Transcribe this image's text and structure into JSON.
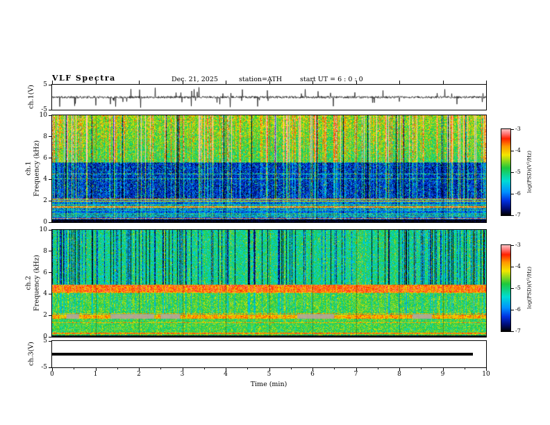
{
  "header": {
    "title": "VLF Spectra",
    "date": "Dec. 21, 2025",
    "station": "station=ATH",
    "start_ut": "start UT =  6 : 0 : 0"
  },
  "axes": {
    "x": {
      "label": "Time (min)",
      "ticks": [
        "0",
        "1",
        "2",
        "3",
        "4",
        "5",
        "6",
        "7",
        "8",
        "9",
        "10"
      ],
      "range": [
        0,
        10
      ]
    },
    "wave1": {
      "label": "ch.1(V)",
      "ticks": [
        "5",
        "-5"
      ],
      "range": [
        -5,
        5
      ]
    },
    "spec1": {
      "channel": "ch.1",
      "freq_label": "Frequency (kHz)",
      "ticks": [
        "10",
        "8",
        "6",
        "4",
        "2",
        "0"
      ],
      "range": [
        0,
        10
      ]
    },
    "spec2": {
      "channel": "ch.2",
      "freq_label": "Frequency (kHz)",
      "ticks": [
        "10",
        "8",
        "6",
        "4",
        "2",
        "0"
      ],
      "range": [
        0,
        10
      ]
    },
    "wave3": {
      "label": "ch.3(V)",
      "ticks": [
        "5",
        "-5"
      ],
      "range": [
        -5,
        5
      ]
    }
  },
  "colorbar": {
    "label": "log(PSD)(V²/Hz)",
    "ticks": [
      "-3",
      "-4",
      "-5",
      "-6",
      "-7"
    ],
    "range": [
      -7,
      -3
    ],
    "stops": [
      {
        "pos": 0.0,
        "color": "#ffc2c2"
      },
      {
        "pos": 0.05,
        "color": "#ff7a7a"
      },
      {
        "pos": 0.11,
        "color": "#ff2000"
      },
      {
        "pos": 0.2,
        "color": "#ff9800"
      },
      {
        "pos": 0.3,
        "color": "#f2e600"
      },
      {
        "pos": 0.45,
        "color": "#1ec83c"
      },
      {
        "pos": 0.6,
        "color": "#00dcd4"
      },
      {
        "pos": 0.73,
        "color": "#0090ff"
      },
      {
        "pos": 0.83,
        "color": "#0030e0"
      },
      {
        "pos": 0.92,
        "color": "#000c78"
      },
      {
        "pos": 1.0,
        "color": "#000000"
      }
    ]
  },
  "chart_data": [
    {
      "type": "line",
      "name": "ch1-waveform",
      "description": "ch.1 voltage time series: broadband noise around 0 V with frequent impulsive sferic spikes reaching ±5 V across the full 10 minutes",
      "x_range": [
        0,
        10
      ],
      "y_range": [
        -5,
        5
      ],
      "gen": {
        "seed": 11,
        "base_amp": 0.5,
        "spike_prob": 0.045,
        "spike_amp": [
          1.5,
          4.6
        ]
      }
    },
    {
      "type": "heatmap",
      "name": "ch1-spectrogram",
      "description": "ch.1 VLF spectrogram 0-10 kHz: green background with yellow/red vertical sferic streaks above ~5.6 kHz, dark-blue band 2.2-5.6 kHz with cyan speckle, striped blue/red band 0.25-2.2 kHz, near-black band below 0.25 kHz",
      "x_range": [
        0,
        10
      ],
      "y_range": [
        0,
        10
      ],
      "z_range": [
        -7,
        -3
      ],
      "gen": {
        "seed": 23,
        "streak_levels": [
          {
            "p": 0.14,
            "min": 0.7,
            "max": 2.1
          },
          {
            "p": 0.4,
            "min": 0.0,
            "max": 0.6
          },
          {
            "p": 0.43,
            "min": -1.8,
            "max": -1.2
          }
        ],
        "bands": [
          {
            "fmin": 0.0,
            "fmax": 0.25,
            "base": -7.0,
            "noise": 0.25,
            "streak": 0.0
          },
          {
            "fmin": 0.25,
            "fmax": 2.2,
            "base": -6.15,
            "noise": 0.55,
            "streak": 0.35,
            "row_levels": [
              {
                "p": 0.22,
                "boost": 2.5
              },
              {
                "p": 0.45,
                "boost": 1.1
              }
            ]
          },
          {
            "fmin": 2.2,
            "fmax": 5.6,
            "base": -6.5,
            "noise": 0.45,
            "streak": 0.9,
            "speckle_p": 0.1,
            "speckle": 1.3,
            "row_levels": [
              {
                "p": 0.07,
                "boost": 1.1
              }
            ]
          },
          {
            "fmin": 5.6,
            "fmax": 10.0,
            "base": -4.9,
            "noise": 0.5,
            "streak": 1.25,
            "grad": 0.35,
            "speckle_p": 0.05,
            "speckle": 1.0
          }
        ]
      }
    },
    {
      "type": "heatmap",
      "name": "ch2-spectrogram",
      "description": "ch.2 VLF spectrogram 0-10 kHz: cyan-green background above ~5 kHz crossed by dark-blue vertical streaks, strong yellow/red horizontal band near 4.5 kHz, green 2-4 kHz, orange band near 1.9 kHz, green below with thin red line near 0.3 kHz and gray interference patches near 2 kHz",
      "x_range": [
        0,
        10
      ],
      "y_range": [
        0,
        10
      ],
      "z_range": [
        -7,
        -3
      ],
      "gen": {
        "seed": 37,
        "streak_levels": [
          {
            "p": 0.2,
            "min": -2.0,
            "max": -0.9
          },
          {
            "p": 0.34,
            "min": 0.0,
            "max": 0.55
          }
        ],
        "bands": [
          {
            "fmin": 0.0,
            "fmax": 0.15,
            "base": -7.0,
            "noise": 0.2,
            "streak": 0.0
          },
          {
            "fmin": 0.15,
            "fmax": 0.28,
            "base": -4.7,
            "noise": 0.5,
            "streak": 0.1
          },
          {
            "fmin": 0.28,
            "fmax": 0.38,
            "base": -3.7,
            "noise": 0.4,
            "streak": 0.1
          },
          {
            "fmin": 0.38,
            "fmax": 1.7,
            "base": -4.75,
            "noise": 0.5,
            "streak": 0.15,
            "row_levels": [
              {
                "p": 0.06,
                "boost": 0.8
              }
            ]
          },
          {
            "fmin": 1.7,
            "fmax": 2.05,
            "base": -3.9,
            "noise": 0.45,
            "streak": 0.2
          },
          {
            "fmin": 2.05,
            "fmax": 4.15,
            "base": -4.75,
            "noise": 0.5,
            "streak": 0.45,
            "row_levels": [
              {
                "p": 0.05,
                "boost": 0.8
              }
            ]
          },
          {
            "fmin": 4.15,
            "fmax": 4.85,
            "base": -3.6,
            "noise": 0.45,
            "streak": 0.25
          },
          {
            "fmin": 4.85,
            "fmax": 10.0,
            "base": -5.15,
            "noise": 0.55,
            "streak": 1.0,
            "speckle_p": 0.04,
            "speckle": 0.8
          }
        ],
        "patches": [
          {
            "t": [
              0.33,
              0.62
            ],
            "f": [
              1.68,
              2.12
            ]
          },
          {
            "t": [
              1.35,
              2.35
            ],
            "f": [
              1.68,
              2.12
            ]
          },
          {
            "t": [
              2.5,
              2.95
            ],
            "f": [
              1.68,
              2.12
            ]
          },
          {
            "t": [
              5.65,
              6.5
            ],
            "f": [
              1.68,
              2.12
            ]
          },
          {
            "t": [
              8.3,
              8.75
            ],
            "f": [
              1.68,
              2.12
            ]
          }
        ]
      }
    },
    {
      "type": "line",
      "name": "ch3-flat",
      "description": "ch.3 voltage time series: constant 0 V thick flat line from 0 to ~9.7 min (channel inactive)",
      "x_range": [
        0,
        9.7
      ],
      "y_range": [
        -5,
        5
      ],
      "value": 0
    }
  ]
}
